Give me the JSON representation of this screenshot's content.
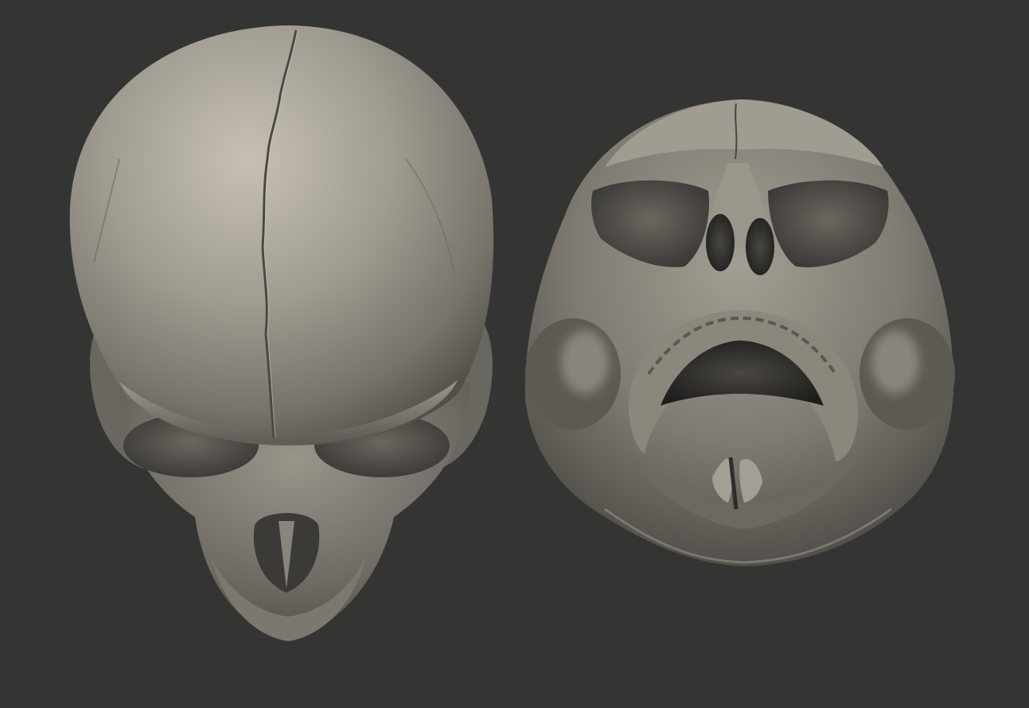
{
  "scene": {
    "background_color": "#343532",
    "bone_light": "#c3bdb1",
    "bone_mid": "#8f8a80",
    "bone_dark": "#57544e",
    "cavity_color": "#1f1e1b",
    "shadow_color": "#262624"
  },
  "objects": [
    {
      "name": "skull-top-view",
      "description_visible": false
    },
    {
      "name": "skull-bottom-view",
      "description_visible": false
    }
  ]
}
